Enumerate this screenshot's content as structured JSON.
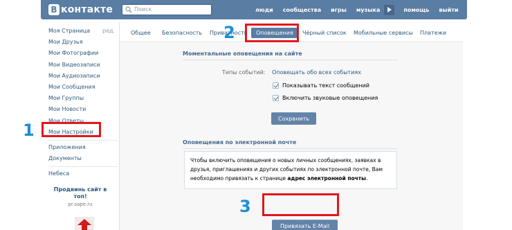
{
  "header": {
    "logo_mark": "В",
    "logo_text": "контакте",
    "search_placeholder": "Поиск",
    "nav": [
      "люди",
      "сообщества",
      "игры",
      "музыка",
      "помощь",
      "выйти"
    ]
  },
  "sidebar": {
    "items": [
      "Моя Страница",
      "Мои Друзья",
      "Мои Фотографии",
      "Мои Видеозаписи",
      "Мои Аудиозаписи",
      "Мои Сообщения",
      "Мои Группы",
      "Мои Новости",
      "Мои Ответы",
      "Мои Настройки"
    ],
    "edit_label": "ред.",
    "extra_items": [
      "Приложения",
      "Документы"
    ],
    "bottom_items": [
      "Небеса"
    ],
    "promo_title": "Продвинь сайт в топ!",
    "promo_site": "pr.sape.ru"
  },
  "tabs": [
    "Общее",
    "Безопасность",
    "Приватность",
    "Оповещения",
    "Чёрный список",
    "Мобильные сервисы",
    "Платежи"
  ],
  "active_tab": "Оповещения",
  "instant": {
    "title": "Моментальные оповещения на сайте",
    "event_types_label": "Типы событий:",
    "event_types_value": "Оповещать обо всех событиях",
    "show_text_label": "Показывать текст сообщений",
    "show_text_checked": true,
    "sound_label": "Включить звуковые оповещения",
    "sound_checked": true,
    "save_button": "Сохранить"
  },
  "email": {
    "title": "Оповещения по электронной почте",
    "info_text": "Чтобы включить оповещения о новых личных сообщениях, заявках в друзья, приглашениях и других событиях по электронной почте, Вам необходимо привязать к странице",
    "info_bold": "адрес электронной почты",
    "info_end": ".",
    "link_button": "Привязать E-Mail"
  },
  "annotations": [
    "1",
    "2",
    "3"
  ],
  "colors": {
    "header_blue": "#597da3",
    "link_blue": "#2b587a",
    "highlight_red": "#e3161b",
    "annotation_blue": "#1b8ed8"
  }
}
